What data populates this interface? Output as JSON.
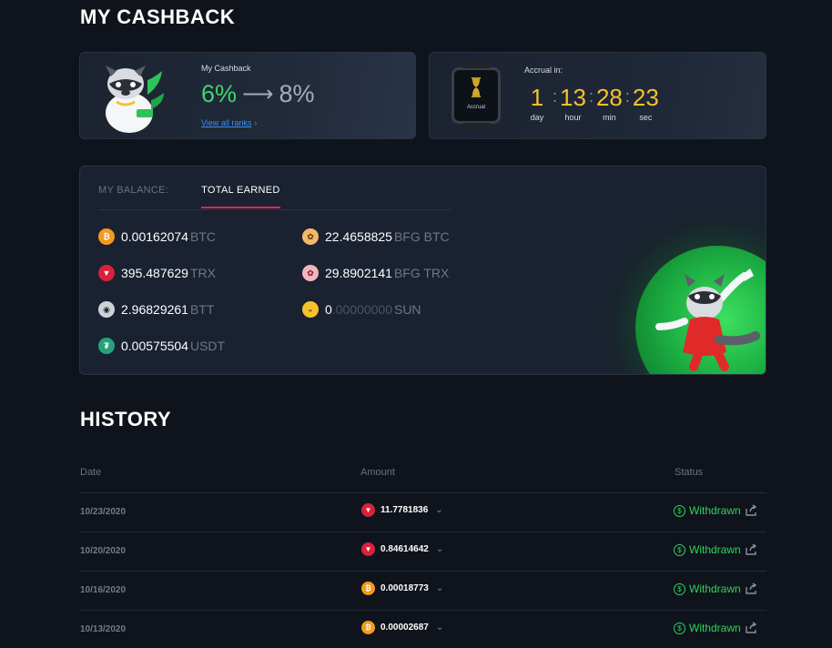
{
  "page": {
    "title": "MY CASHBACK"
  },
  "cashback": {
    "label": "My Cashback",
    "current_rate": "6%",
    "next_rate": "8%",
    "arrow": "⟶",
    "link_text": "View all ranks",
    "link_icon": "›"
  },
  "accrual": {
    "label": "Accrual in:",
    "watch_label": "Accrual",
    "countdown": [
      {
        "value": "1",
        "unit": "day"
      },
      {
        "value": "13",
        "unit": "hour"
      },
      {
        "value": "28",
        "unit": "min"
      },
      {
        "value": "23",
        "unit": "sec"
      }
    ]
  },
  "balance": {
    "tabs": [
      {
        "label": "MY BALANCE:",
        "active": false
      },
      {
        "label": "TOTAL EARNED",
        "active": true
      }
    ],
    "coins": [
      {
        "amount": "0.00162074",
        "amount_dim": "",
        "symbol": "BTC",
        "icon": "btc-icon",
        "color": "#f39a1e"
      },
      {
        "amount": "395.487629",
        "amount_dim": "",
        "symbol": "TRX",
        "icon": "trx-icon",
        "color": "#d9213b"
      },
      {
        "amount": "2.96829261",
        "amount_dim": "",
        "symbol": "BTT",
        "icon": "btt-icon",
        "color": "#cfd3d8"
      },
      {
        "amount": "0.00575504",
        "amount_dim": "",
        "symbol": "USDT",
        "icon": "usdt-icon",
        "color": "#26a17b"
      },
      {
        "amount": "22.4658825",
        "amount_dim": "",
        "symbol": "BFG BTC",
        "icon": "bfg-btc-icon",
        "color": "#f2b86a"
      },
      {
        "amount": "29.8902141",
        "amount_dim": "",
        "symbol": "BFG TRX",
        "icon": "bfg-trx-icon",
        "color": "#f3b4bf"
      },
      {
        "amount": "0",
        "amount_dim": ".00000000",
        "symbol": "SUN",
        "icon": "sun-icon",
        "color": "#f4c22b"
      }
    ]
  },
  "history": {
    "title": "HISTORY",
    "columns": {
      "date": "Date",
      "amount": "Amount",
      "status": "Status"
    },
    "rows": [
      {
        "date": "10/23/2020",
        "amount": "11.7781836",
        "coin": "trx-icon",
        "status": "Withdrawn"
      },
      {
        "date": "10/20/2020",
        "amount": "0.84614642",
        "coin": "trx-icon",
        "status": "Withdrawn"
      },
      {
        "date": "10/16/2020",
        "amount": "0.00018773",
        "coin": "btc-icon",
        "status": "Withdrawn"
      },
      {
        "date": "10/13/2020",
        "amount": "0.00002687",
        "coin": "btc-icon",
        "status": "Withdrawn"
      }
    ]
  },
  "colors": {
    "accent_green": "#2fd35c",
    "accent_yellow": "#f4c22b",
    "tab_underline": "#e3245a",
    "link_blue": "#3b8ef0"
  }
}
